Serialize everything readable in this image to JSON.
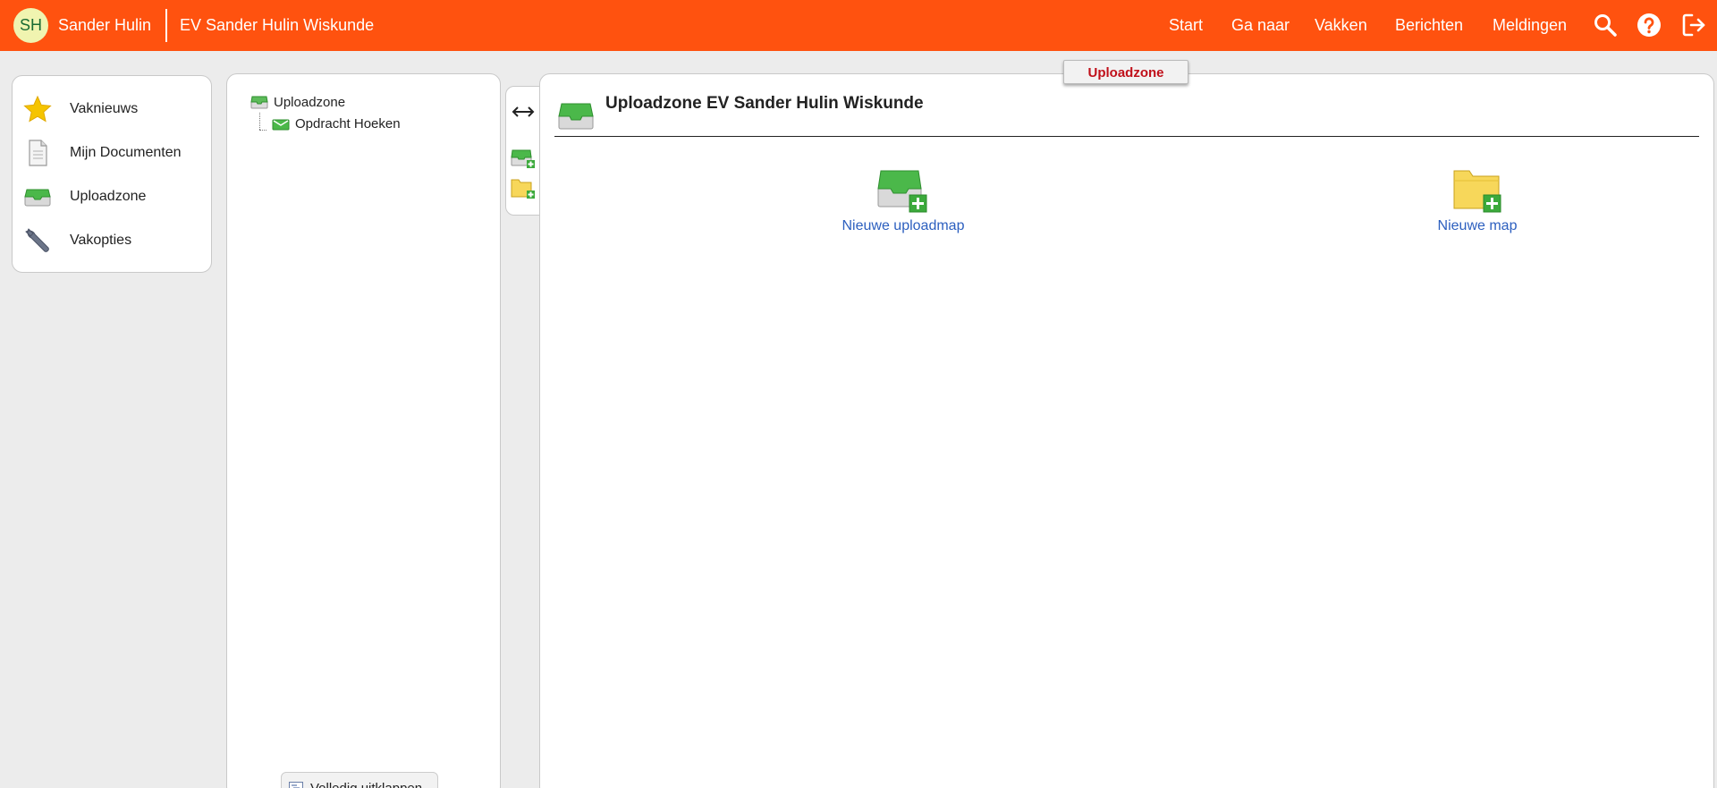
{
  "header": {
    "avatar_initials": "SH",
    "user_name": "Sander Hulin",
    "course_title": "EV Sander Hulin Wiskunde",
    "nav": [
      "Start",
      "Ga naar",
      "Vakken",
      "Berichten",
      "Meldingen"
    ],
    "icons": [
      "search-icon",
      "help-icon",
      "logout-icon"
    ],
    "color": "#ff520f"
  },
  "sidebar": {
    "items": [
      {
        "label": "Vaknieuws",
        "icon": "star-icon"
      },
      {
        "label": "Mijn Documenten",
        "icon": "document-icon"
      },
      {
        "label": "Uploadzone",
        "icon": "inbox-icon"
      },
      {
        "label": "Vakopties",
        "icon": "wrench-icon"
      }
    ]
  },
  "tree": {
    "root": "Uploadzone",
    "children": [
      "Opdracht Hoeken"
    ],
    "expand_button": "Volledig uitklappen"
  },
  "tab_badge": "Uploadzone",
  "main": {
    "title": "Uploadzone EV Sander Hulin Wiskunde",
    "actions": [
      "Nieuwe uploadmap",
      "Nieuwe map"
    ]
  }
}
